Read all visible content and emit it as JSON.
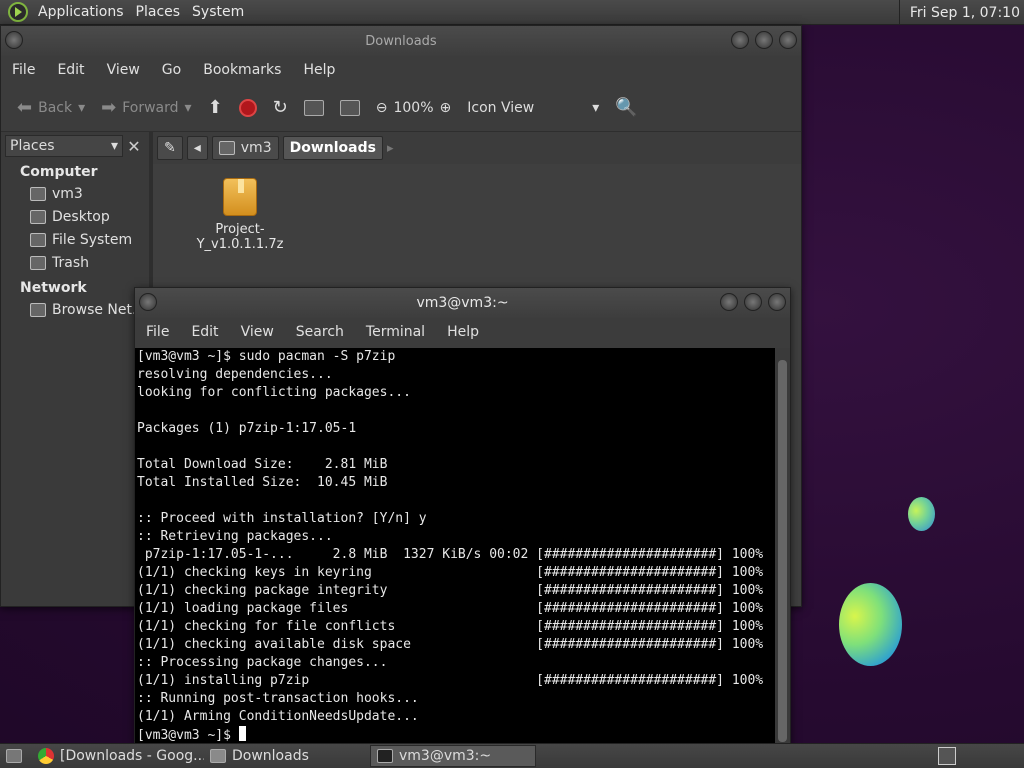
{
  "top_panel": {
    "menus": [
      "Applications",
      "Places",
      "System"
    ],
    "clock": "Fri Sep  1, 07:10"
  },
  "file_manager": {
    "title": "Downloads",
    "menus": [
      "File",
      "Edit",
      "View",
      "Go",
      "Bookmarks",
      "Help"
    ],
    "toolbar": {
      "back": "Back",
      "forward": "Forward",
      "zoom": "100%",
      "view_mode": "Icon View"
    },
    "sidebar": {
      "selector": "Places",
      "sections": [
        {
          "heading": "Computer",
          "items": [
            "vm3",
            "Desktop",
            "File System",
            "Trash"
          ]
        },
        {
          "heading": "Network",
          "items": [
            "Browse Net..."
          ]
        }
      ]
    },
    "pathbar": [
      "vm3",
      "Downloads"
    ],
    "files": [
      {
        "name": "Project-Y_v1.0.1.1.7z",
        "icon": "archive-icon"
      }
    ]
  },
  "terminal": {
    "title": "vm3@vm3:~",
    "menus": [
      "File",
      "Edit",
      "View",
      "Search",
      "Terminal",
      "Help"
    ],
    "lines": [
      "[vm3@vm3 ~]$ sudo pacman -S p7zip",
      "resolving dependencies...",
      "looking for conflicting packages...",
      "",
      "Packages (1) p7zip-1:17.05-1",
      "",
      "Total Download Size:    2.81 MiB",
      "Total Installed Size:  10.45 MiB",
      "",
      ":: Proceed with installation? [Y/n] y",
      ":: Retrieving packages...",
      " p7zip-1:17.05-1-...     2.8 MiB  1327 KiB/s 00:02 [######################] 100%",
      "(1/1) checking keys in keyring                     [######################] 100%",
      "(1/1) checking package integrity                   [######################] 100%",
      "(1/1) loading package files                        [######################] 100%",
      "(1/1) checking for file conflicts                  [######################] 100%",
      "(1/1) checking available disk space                [######################] 100%",
      ":: Processing package changes...",
      "(1/1) installing p7zip                             [######################] 100%",
      ":: Running post-transaction hooks...",
      "(1/1) Arming ConditionNeedsUpdate..."
    ],
    "prompt": "[vm3@vm3 ~]$ "
  },
  "taskbar": {
    "tasks": [
      {
        "label": "[Downloads - Goog...",
        "icon": "chrome-icon"
      },
      {
        "label": "Downloads",
        "icon": "folder-icon"
      },
      {
        "label": "vm3@vm3:~",
        "icon": "terminal-icon"
      }
    ]
  }
}
